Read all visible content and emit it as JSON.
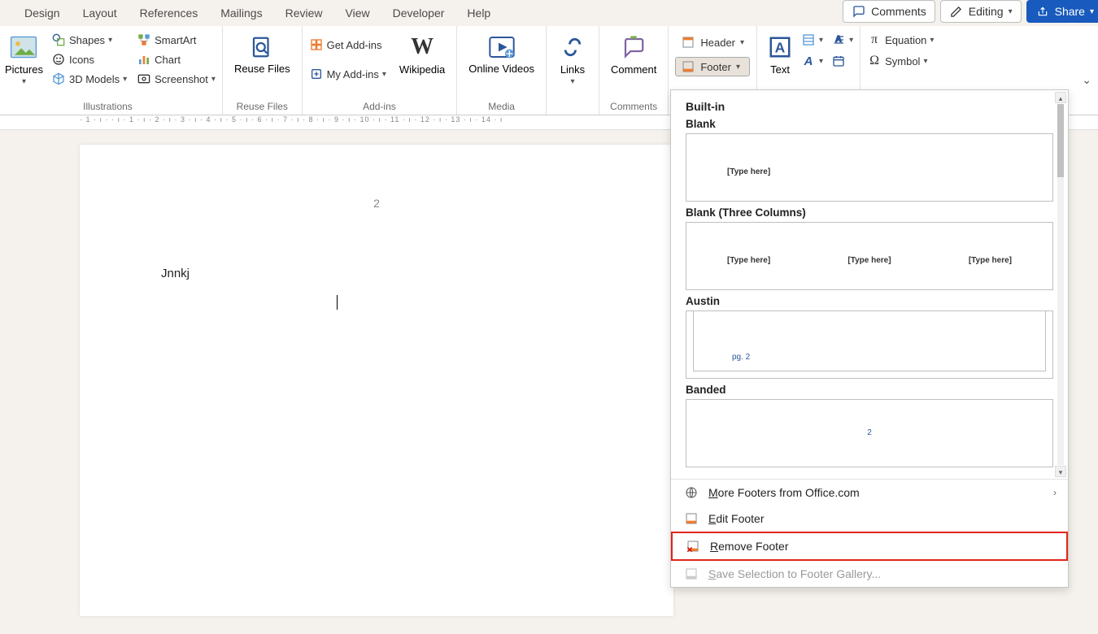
{
  "tabs": [
    "Design",
    "Layout",
    "References",
    "Mailings",
    "Review",
    "View",
    "Developer",
    "Help"
  ],
  "right": {
    "comments": "Comments",
    "editing": "Editing",
    "share": "Share"
  },
  "ribbon": {
    "pictures": "Pictures",
    "shapes": "Shapes",
    "icons": "Icons",
    "models3d": "3D Models",
    "smartart": "SmartArt",
    "chart": "Chart",
    "screenshot": "Screenshot",
    "illustrations_label": "Illustrations",
    "reuse_files": "Reuse Files",
    "reuse_files_label": "Reuse Files",
    "get_addins": "Get Add-ins",
    "my_addins": "My Add-ins",
    "wikipedia": "Wikipedia",
    "addins_label": "Add-ins",
    "online_videos": "Online Videos",
    "media_label": "Media",
    "links": "Links",
    "comment": "Comment",
    "comments_label": "Comments",
    "header": "Header",
    "footer": "Footer",
    "text": "Text",
    "equation": "Equation",
    "symbol": "Symbol"
  },
  "ruler_text": "· 1 · ı · · ı · 1 · ı · 2 · ı · 3 · ı · 4 · ı · 5 · ı · 6 · ı · 7 · ı · 8 · ı · 9 · ı · 10 · ı · 11 · ı · 12 · ı · 13 · ı · 14 · ı",
  "doc": {
    "page_number": "2",
    "body": "Jnnkj"
  },
  "footer_menu": {
    "builtin": "Built-in",
    "blank": "Blank",
    "type_here": "[Type here]",
    "blank3": "Blank (Three Columns)",
    "austin": "Austin",
    "austin_pg": "pg. 2",
    "banded": "Banded",
    "banded_num": "2",
    "more": "More Footers from Office.com",
    "edit": "Edit Footer",
    "remove": "Remove Footer",
    "save": "Save Selection to Footer Gallery..."
  }
}
